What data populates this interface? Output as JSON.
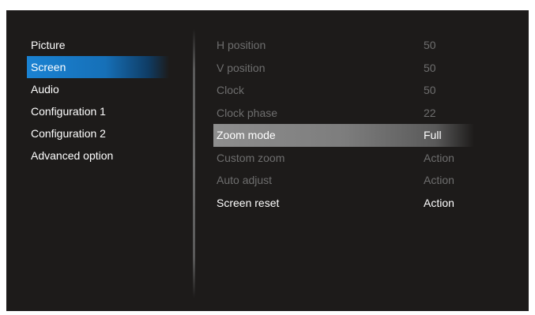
{
  "left_menu": {
    "items": [
      {
        "label": "Picture"
      },
      {
        "label": "Screen",
        "selected": true
      },
      {
        "label": "Audio"
      },
      {
        "label": "Configuration 1"
      },
      {
        "label": "Configuration 2"
      },
      {
        "label": "Advanced option"
      }
    ]
  },
  "right_menu": {
    "rows": [
      {
        "label": "H position",
        "value": "50"
      },
      {
        "label": "V position",
        "value": "50"
      },
      {
        "label": "Clock",
        "value": "50"
      },
      {
        "label": "Clock phase",
        "value": "22"
      },
      {
        "label": "Zoom mode",
        "value": "Full",
        "highlighted": true
      },
      {
        "label": "Custom zoom",
        "value": "Action"
      },
      {
        "label": "Auto adjust",
        "value": "Action"
      },
      {
        "label": "Screen reset",
        "value": "Action"
      }
    ]
  }
}
